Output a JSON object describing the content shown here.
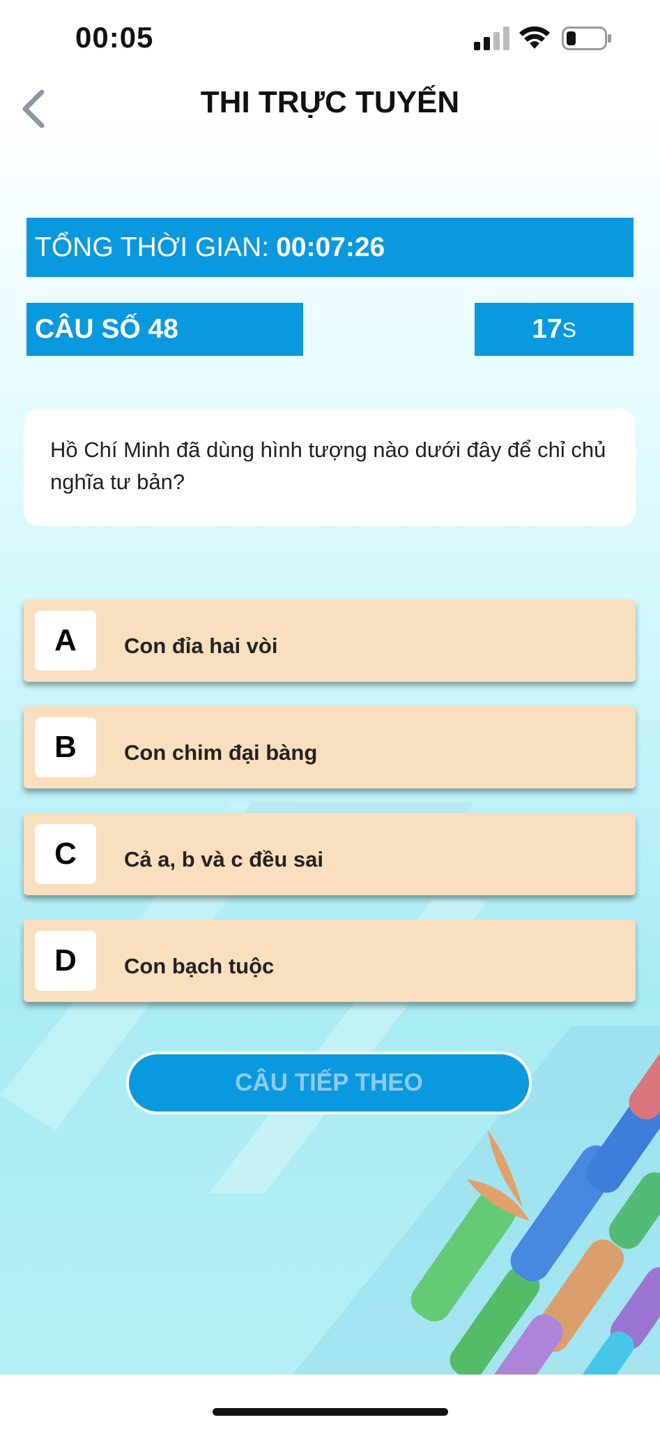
{
  "status_bar": {
    "time": "00:05"
  },
  "header": {
    "title": "THI TRỰC TUYẾN"
  },
  "total_time": {
    "label": "TỔNG THỜI GIAN:",
    "value": "00:07:26"
  },
  "question_number": {
    "label": "CÂU SỐ 48"
  },
  "countdown": {
    "value": "17",
    "unit": "S"
  },
  "question": {
    "text": "Hồ Chí Minh đã dùng hình tượng nào dưới đây để chỉ chủ nghĩa tư bản?"
  },
  "options": [
    {
      "letter": "A",
      "text": "Con đỉa hai vòi"
    },
    {
      "letter": "B",
      "text": "Con chim đại bàng"
    },
    {
      "letter": "C",
      "text": "Cả a, b và c đều sai"
    },
    {
      "letter": "D",
      "text": "Con bạch tuộc"
    }
  ],
  "next_button": {
    "label": "CÂU TIẾP THEO"
  },
  "colors": {
    "accent": "#0a99de",
    "option_bg": "#fadfbf",
    "next_label": "#8fcbee"
  },
  "icons": [
    "signal-icon",
    "wifi-icon",
    "battery-icon",
    "back-chevron-icon"
  ]
}
